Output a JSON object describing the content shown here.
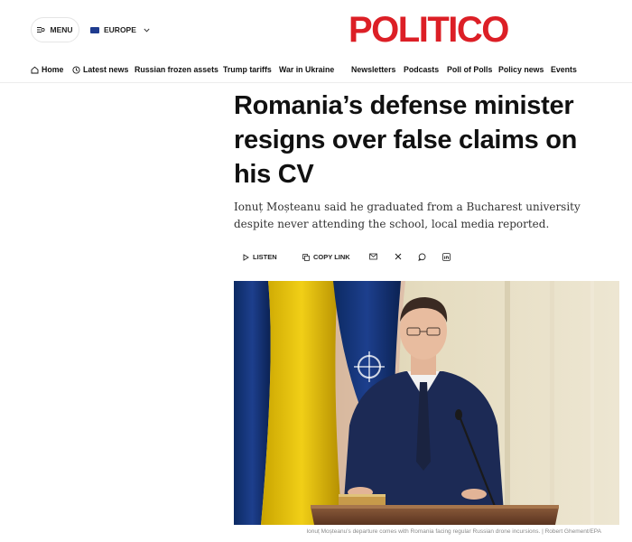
{
  "header": {
    "menu_label": "MENU",
    "edition_label": "EUROPE",
    "logo_text": "POLITICO",
    "brand_color": "#dc1f26"
  },
  "nav": {
    "items": [
      {
        "label": "Home",
        "icon": "home-icon"
      },
      {
        "label": "Latest news",
        "icon": "clock-icon"
      },
      {
        "label": "Russian frozen assets"
      },
      {
        "label": "Trump tariffs"
      },
      {
        "label": "War in Ukraine"
      },
      {
        "label": "Newsletters"
      },
      {
        "label": "Podcasts"
      },
      {
        "label": "Poll of Polls"
      },
      {
        "label": "Policy news"
      },
      {
        "label": "Events"
      }
    ]
  },
  "article": {
    "headline": "Romania’s defense minister resigns over false claims on his CV",
    "dek": "Ionuț Moșteanu said he graduated from a Bucharest university despite never attending the school, local media reported.",
    "share": {
      "listen_label": "LISTEN",
      "copy_link_label": "COPY LINK",
      "icons": [
        "mail-icon",
        "x-icon",
        "whatsapp-icon",
        "linkedin-icon"
      ]
    },
    "image_caption": "Ionuț Moșteanu’s departure comes with Romania facing regular Russian drone incursions. | Robert Ghement/EPA"
  }
}
